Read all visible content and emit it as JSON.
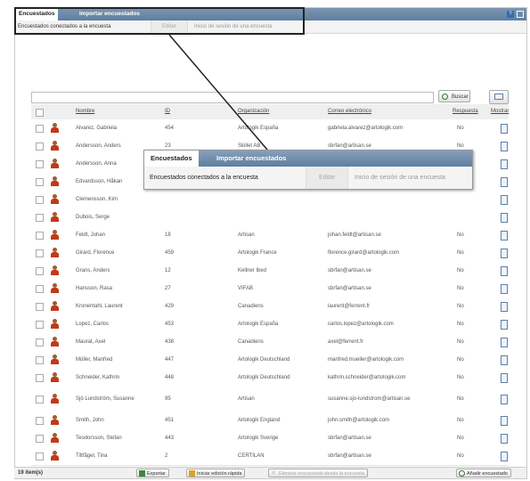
{
  "tabs": {
    "active": "Encuestados",
    "import": "Importar encuestados"
  },
  "subbar": {
    "label": "Encuestados conectados a la encuesta",
    "edit": "Editar",
    "session": "Inicio de sesión de una encuesta"
  },
  "search": {
    "value": "",
    "button": "Buscar"
  },
  "columns": {
    "name": "Nombre",
    "id": "ID",
    "org": "Organización",
    "email": "Correo electrónico",
    "response": "Respuesta",
    "show": "Mostrar"
  },
  "rows": [
    {
      "name": "Alvarez, Gabriela",
      "id": "454",
      "org": "Artologik España",
      "email": "gabriela.alvarez@artologik.com",
      "response": "No"
    },
    {
      "name": "Andersson, Anders",
      "id": "23",
      "org": "Skillet AB",
      "email": "sbrfan@artisan.se",
      "response": "No"
    },
    {
      "name": "Andersson, Anna",
      "id": "",
      "org": "",
      "email": "",
      "response": ""
    },
    {
      "name": "Edvardsson, Håkan",
      "id": "",
      "org": "",
      "email": "",
      "response": ""
    },
    {
      "name": "Clemensson, Kim",
      "id": "",
      "org": "",
      "email": "",
      "response": ""
    },
    {
      "name": "Dubois, Serge",
      "id": "",
      "org": "",
      "email": "",
      "response": ""
    },
    {
      "name": "Feldt, Johan",
      "id": "18",
      "org": "Artisan",
      "email": "johan.feldt@artisan.se",
      "response": "No"
    },
    {
      "name": "Girard, Florence",
      "id": "459",
      "org": "Artologik France",
      "email": "florence.girard@artologik.com",
      "response": "No"
    },
    {
      "name": "Grans, Anders",
      "id": "12",
      "org": "Kellner Ibed",
      "email": "sbrfan@artisan.se",
      "response": "No"
    },
    {
      "name": "Hansson, Rasa",
      "id": "27",
      "org": "VIFAB",
      "email": "sbrfan@artisan.se",
      "response": "No"
    },
    {
      "name": "Kronentahl, Laurent",
      "id": "429",
      "org": "Canadiens",
      "email": "laurent@ferrent.fr",
      "response": "No"
    },
    {
      "name": "Lopez, Carlos",
      "id": "453",
      "org": "Artologik España",
      "email": "carlos.lopez@artologik.com",
      "response": "No"
    },
    {
      "name": "Maurat, Axel",
      "id": "438",
      "org": "Canadiens",
      "email": "axel@ferrent.fr",
      "response": "No"
    },
    {
      "name": "Müller, Manfred",
      "id": "447",
      "org": "Artologik Deutschland",
      "email": "manfred.mueller@artologik.com",
      "response": "No"
    },
    {
      "name": "Schneider, Kathrin",
      "id": "448",
      "org": "Artologik Deutschland",
      "email": "kathrin.schneider@artologik.com",
      "response": "No"
    },
    {
      "name": "Sjö Lundström, Susanne",
      "id": "95",
      "org": "Artisan",
      "email": "susanne.sjo-lundstrom@artisan.se",
      "response": "No"
    },
    {
      "name": "Smith, John",
      "id": "451",
      "org": "Artologik England",
      "email": "john.smith@artologik.com",
      "response": "No"
    },
    {
      "name": "Teodorsson, Stefan",
      "id": "443",
      "org": "Artologik Sverige",
      "email": "sbrfan@artisan.se",
      "response": "No"
    },
    {
      "name": "Tiltfågel, Tina",
      "id": "2",
      "org": "CERTILAN",
      "email": "sbrfan@artisan.se",
      "response": "No"
    }
  ],
  "footer": {
    "count": "19 item(s)",
    "export": "Exportar",
    "quick_edit": "Iniciar edición rápida",
    "remove": "Eliminar encuestado desde la encuesta",
    "add": "Añadir encuestado"
  },
  "callout": {
    "tab_active": "Encuestados",
    "tab_import": "Importar encuestados",
    "label": "Encuestados conectados a la encuesta",
    "edit": "Editar",
    "session": "Inicio de sesión de una encuesta"
  },
  "colors": {
    "header_blue": "#5f7e9f",
    "user_icon": "#c03a1a",
    "add_icon": "#2f7a2a"
  },
  "icons": {
    "user": "user-icon",
    "show": "document-icon",
    "search": "search-icon",
    "columns": "columns-icon",
    "help": "help-icon"
  }
}
